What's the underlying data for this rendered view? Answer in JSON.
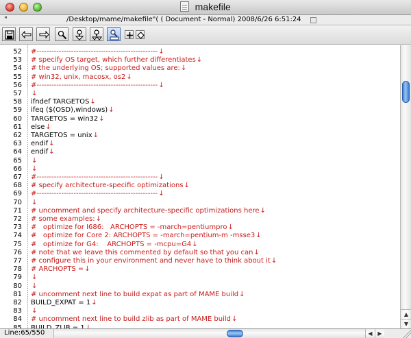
{
  "window": {
    "title": "makefile"
  },
  "pathbar": {
    "quote": "\"",
    "text": "/Desktop/mame/makefile\"( ( Document - Normal)  2008/6/26  6:51:24"
  },
  "toolbar": {
    "buttons": [
      {
        "name": "save-icon"
      },
      {
        "name": "undo-arrow-icon"
      },
      {
        "name": "redo-arrow-icon"
      },
      {
        "name": "search-icon"
      },
      {
        "name": "find-next-icon"
      },
      {
        "name": "find-prev-icon"
      },
      {
        "name": "find-all-icon"
      },
      {
        "name": "plus-icon"
      },
      {
        "name": "diamond-icon"
      }
    ]
  },
  "editor": {
    "eol_mark": "↓",
    "lines": [
      {
        "n": "52",
        "t": "#-------------------------------------------------",
        "c": true
      },
      {
        "n": "53",
        "t": "# specify OS target, which further differentiates",
        "c": true
      },
      {
        "n": "54",
        "t": "# the underlying OS; supported values are:",
        "c": true
      },
      {
        "n": "55",
        "t": "# win32, unix, macosx, os2",
        "c": true
      },
      {
        "n": "56",
        "t": "#-------------------------------------------------",
        "c": true
      },
      {
        "n": "57",
        "t": "",
        "c": false
      },
      {
        "n": "58",
        "t": "ifndef TARGETOS",
        "c": false
      },
      {
        "n": "59",
        "t": "ifeq ($(OSD),windows)",
        "c": false
      },
      {
        "n": "60",
        "t": "TARGETOS = win32",
        "c": false
      },
      {
        "n": "61",
        "t": "else",
        "c": false
      },
      {
        "n": "62",
        "t": "TARGETOS = unix",
        "c": false
      },
      {
        "n": "63",
        "t": "endif",
        "c": false
      },
      {
        "n": "64",
        "t": "endif",
        "c": false
      },
      {
        "n": "65",
        "t": "",
        "c": false
      },
      {
        "n": "66",
        "t": "",
        "c": false
      },
      {
        "n": "67",
        "t": "#-------------------------------------------------",
        "c": true
      },
      {
        "n": "68",
        "t": "# specify architecture-specific optimizations",
        "c": true
      },
      {
        "n": "69",
        "t": "#-------------------------------------------------",
        "c": true
      },
      {
        "n": "70",
        "t": "",
        "c": false
      },
      {
        "n": "71",
        "t": "# uncomment and specify architecture-specific optimizations here",
        "c": true
      },
      {
        "n": "72",
        "t": "# some examples:",
        "c": true
      },
      {
        "n": "73",
        "t": "#   optimize for I686:   ARCHOPTS = -march=pentiumpro",
        "c": true
      },
      {
        "n": "74",
        "t": "#   optimize for Core 2: ARCHOPTS = -march=pentium-m -msse3",
        "c": true
      },
      {
        "n": "75",
        "t": "#   optimize for G4:    ARCHOPTS = -mcpu=G4",
        "c": true
      },
      {
        "n": "76",
        "t": "# note that we leave this commented by default so that you can",
        "c": true
      },
      {
        "n": "77",
        "t": "# configure this in your environment and never have to think about it",
        "c": true
      },
      {
        "n": "78",
        "t": "# ARCHOPTS =",
        "c": true
      },
      {
        "n": "79",
        "t": "",
        "c": false
      },
      {
        "n": "80",
        "t": "",
        "c": false
      },
      {
        "n": "81",
        "t": "# uncomment next line to build expat as part of MAME build",
        "c": true
      },
      {
        "n": "82",
        "t": "BUILD_EXPAT = 1",
        "c": false
      },
      {
        "n": "83",
        "t": "",
        "c": false
      },
      {
        "n": "84",
        "t": "# uncomment next line to build zlib as part of MAME build",
        "c": true
      },
      {
        "n": "85",
        "t": "BUILD_ZLIB = 1",
        "c": false
      }
    ]
  },
  "statusbar": {
    "text": "Line:65/550"
  },
  "scrollbars": {
    "up_arrow": "▲",
    "down_arrow": "▼",
    "left_arrow": "◀",
    "right_arrow": "▶"
  }
}
